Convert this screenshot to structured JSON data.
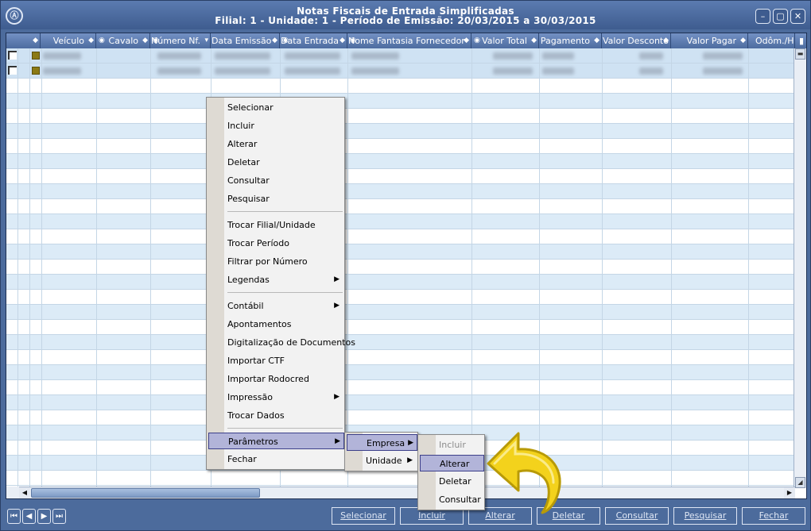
{
  "window": {
    "title_line1": "Notas Fiscais de Entrada Simplificadas",
    "title_line2": "Filial: 1 - Unidade: 1 - Período de Emissão: 20/03/2015 a 30/03/2015",
    "logo_glyph": "Ⓐ",
    "min_glyph": "–",
    "max_glyph": "▢",
    "close_glyph": "✕"
  },
  "grid": {
    "columns": [
      {
        "label": "Veículo"
      },
      {
        "label": "Cavalo"
      },
      {
        "label": "Número Nf."
      },
      {
        "label": "Data Emissão"
      },
      {
        "label": "Data Entrada"
      },
      {
        "label": "Nome Fantasia Fornecedor"
      },
      {
        "label": "Valor Total"
      },
      {
        "label": "Pagamento"
      },
      {
        "label": "Valor Desconto"
      },
      {
        "label": "Valor Pagar"
      },
      {
        "label": "Odôm./H."
      }
    ],
    "rows_with_data": 2,
    "total_rows": 29
  },
  "context_menu": {
    "items": [
      {
        "label": "Selecionar",
        "submenu": false
      },
      {
        "label": "Incluir",
        "submenu": false
      },
      {
        "label": "Alterar",
        "submenu": false
      },
      {
        "label": "Deletar",
        "submenu": false
      },
      {
        "label": "Consultar",
        "submenu": false
      },
      {
        "label": "Pesquisar",
        "submenu": false
      },
      {
        "label": "Trocar Filial/Unidade",
        "submenu": false
      },
      {
        "label": "Trocar Período",
        "submenu": false
      },
      {
        "label": "Filtrar por Número",
        "submenu": false
      },
      {
        "label": "Legendas",
        "submenu": true
      },
      {
        "label": "Contábil",
        "submenu": true
      },
      {
        "label": "Apontamentos",
        "submenu": false
      },
      {
        "label": "Digitalização de Documentos",
        "submenu": false
      },
      {
        "label": "Importar CTF",
        "submenu": false
      },
      {
        "label": "Importar Rodocred",
        "submenu": false
      },
      {
        "label": "Impressão",
        "submenu": true
      },
      {
        "label": "Trocar Dados",
        "submenu": false
      },
      {
        "label": "Parâmetros",
        "submenu": true,
        "highlighted": true
      },
      {
        "label": "Fechar",
        "submenu": false
      }
    ]
  },
  "submenu_parametros": {
    "items": [
      {
        "label": "Empresa",
        "submenu": true,
        "highlighted": true
      },
      {
        "label": "Unidade",
        "submenu": true
      }
    ]
  },
  "submenu_empresa": {
    "items": [
      {
        "label": "Incluir",
        "disabled": true
      },
      {
        "label": "Alterar",
        "highlighted": true
      },
      {
        "label": "Deletar"
      },
      {
        "label": "Consultar"
      }
    ]
  },
  "bottom_bar": {
    "nav": [
      "⏮",
      "◀",
      "▶",
      "⏭"
    ],
    "buttons": [
      "Selecionar",
      "Incluir",
      "Alterar",
      "Deletar",
      "Consultar",
      "Pesquisar",
      "Fechar"
    ]
  },
  "colors": {
    "window_bg": "#4c6b9c",
    "row_alt": "#dcebf7",
    "menu_highlight": "#b2b4d9",
    "pointer": "#f3d21c"
  }
}
